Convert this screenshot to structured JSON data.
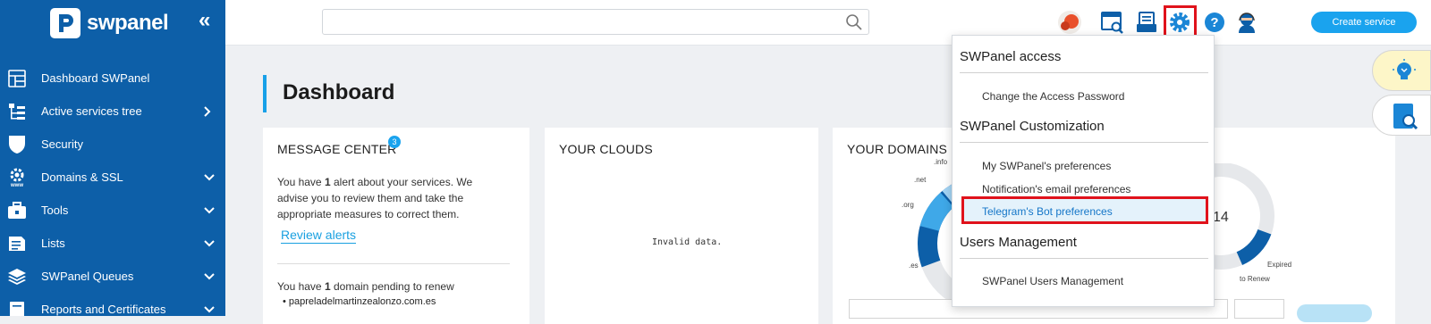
{
  "brand": {
    "name": "swpanel"
  },
  "sidebar": {
    "items": [
      {
        "label": "Dashboard SWPanel",
        "icon": "dashboard-icon",
        "arrow": ""
      },
      {
        "label": "Active services tree",
        "icon": "tree-icon",
        "arrow": "right"
      },
      {
        "label": "Security",
        "icon": "shield-icon",
        "arrow": ""
      },
      {
        "label": "Domains & SSL",
        "icon": "www-gear-icon",
        "arrow": "down"
      },
      {
        "label": "Tools",
        "icon": "toolbox-icon",
        "arrow": "down"
      },
      {
        "label": "Lists",
        "icon": "list-icon",
        "arrow": "down"
      },
      {
        "label": "SWPanel Queues",
        "icon": "layers-icon",
        "arrow": "down"
      },
      {
        "label": "Reports and Certificates",
        "icon": "report-icon",
        "arrow": "down"
      }
    ]
  },
  "search": {
    "placeholder": ""
  },
  "topbar": {
    "create_label": "Create service"
  },
  "page": {
    "title": "Dashboard"
  },
  "message_center": {
    "title": "MESSAGE CENTER",
    "badge": "3",
    "alert_pre": "You have ",
    "alert_count": "1",
    "alert_post": " alert about your services. We advise you to review them and take the appropriate measures to correct them.",
    "review_label": "Review alerts",
    "pending_pre": "You have ",
    "pending_count": "1",
    "pending_post": " domain pending to renew",
    "pending_domain": "• papreladelmartinzealonzo.com.es"
  },
  "clouds": {
    "title": "YOUR CLOUDS",
    "empty": "Invalid data."
  },
  "domains": {
    "title": "YOUR DOMAINS",
    "labels": [
      ".info",
      ".net",
      ".org",
      ".es"
    ],
    "total": "14",
    "legend": [
      "Expired",
      "to Renew"
    ]
  },
  "colors": {
    "sidebar": "#0d5fa8",
    "accent": "#1aa3ee",
    "highlight": "#e0121b"
  },
  "settings_menu": {
    "access": {
      "title": "SWPanel access",
      "items": [
        "Change the Access Password"
      ]
    },
    "customization": {
      "title": "SWPanel Customization",
      "items": [
        "My SWPanel's preferences",
        "Notification's email preferences",
        "Telegram's Bot preferences"
      ]
    },
    "users": {
      "title": "Users Management",
      "items": [
        "SWPanel Users Management"
      ]
    }
  }
}
